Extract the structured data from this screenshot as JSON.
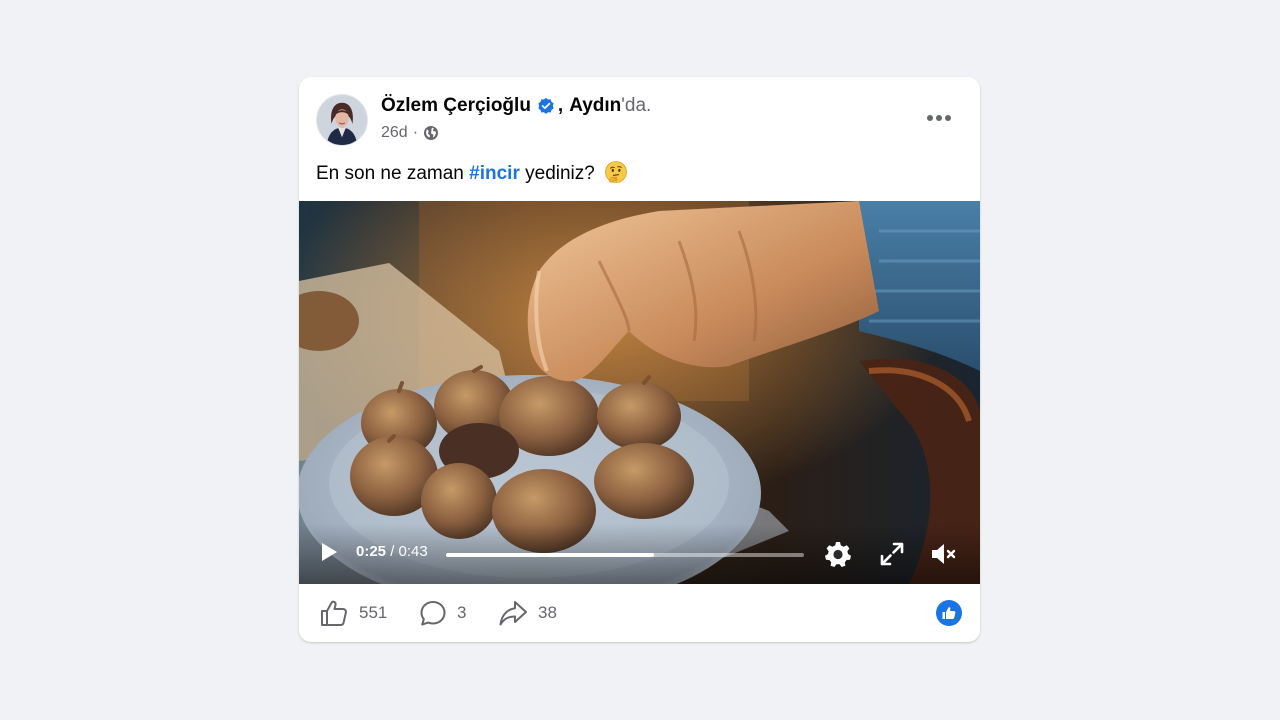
{
  "post": {
    "author": "Özlem Çerçioğlu",
    "separator": ",",
    "location": "Aydın",
    "location_suffix": "'da.",
    "time_ago": "26d",
    "time_dot": "·",
    "caption_before": "En son ne zaman ",
    "hashtag": "#incir",
    "caption_after": " yediniz?",
    "caption_emoji": "thinking-face-emoji",
    "audience_icon": "globe-icon",
    "menu_icon": "more-options-icon"
  },
  "video": {
    "current_time": "0:25",
    "time_separator": " / ",
    "duration": "0:43",
    "progress_fraction": 0.58,
    "controls": {
      "play": "play-icon",
      "settings": "gear-icon",
      "fullscreen": "fullscreen-icon",
      "mute": "speaker-muted-icon"
    }
  },
  "engagement": {
    "likes": "551",
    "comments": "3",
    "shares": "38"
  },
  "colors": {
    "background": "#f0f2f5",
    "card": "#ffffff",
    "accent": "#1b74e4",
    "secondary_text": "#65676b"
  }
}
